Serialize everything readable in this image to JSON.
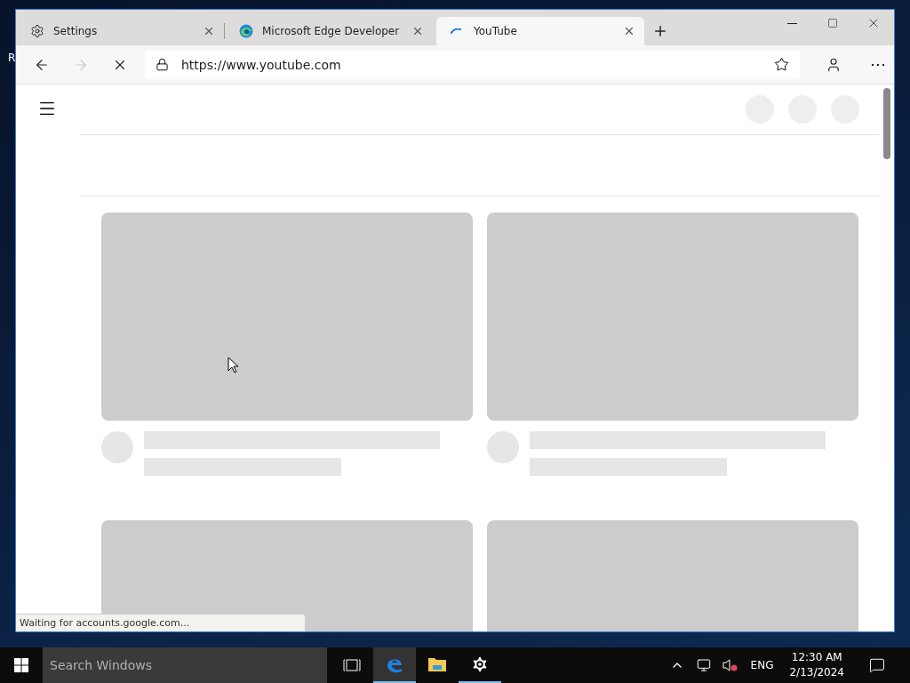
{
  "desktop": {
    "text": "R"
  },
  "browser": {
    "tabs": [
      {
        "title": "Settings",
        "kind": "gear",
        "selected": false
      },
      {
        "title": "Microsoft Edge Developer",
        "kind": "edge",
        "selected": false
      },
      {
        "title": "YouTube",
        "kind": "spinner",
        "selected": true
      }
    ],
    "address": "https://www.youtube.com",
    "loading": true,
    "status": "Waiting for accounts.google.com..."
  },
  "page": {
    "video_cards": [
      {
        "kind": "placeholder"
      },
      {
        "kind": "placeholder"
      },
      {
        "kind": "thumbnail"
      },
      {
        "kind": "thumbnail"
      }
    ]
  },
  "taskbar": {
    "search_placeholder": "Search Windows",
    "apps": [
      {
        "kind": "edge",
        "selected": true,
        "running": true
      },
      {
        "kind": "explorer",
        "selected": false,
        "running": false
      },
      {
        "kind": "settings",
        "selected": false,
        "running": true
      }
    ],
    "language": "ENG",
    "time": "12:30 AM",
    "date": "2/13/2024"
  }
}
